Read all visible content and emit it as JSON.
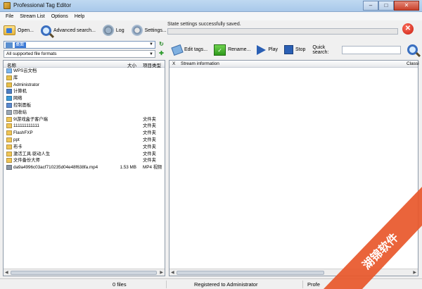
{
  "window": {
    "title": "Professional Tag Editor",
    "controls": {
      "minimize": "–",
      "maximize": "□",
      "close": "✕"
    }
  },
  "menu": [
    "File",
    "Stream List",
    "Options",
    "Help"
  ],
  "left_toolbar": {
    "open": "Open...",
    "advanced_search": "Advanced search...",
    "log": "Log",
    "settings": "Settings..."
  },
  "status": {
    "message": "State settings successfully saved.",
    "progress": 0
  },
  "path": {
    "selected": "桌面"
  },
  "format_filter": "All supported file formats",
  "file_list": {
    "columns": {
      "name": "名称",
      "size": "大小",
      "type": "项目类型"
    },
    "rows": [
      {
        "name": "WPS云文档",
        "size": "",
        "type": "",
        "icon": "cloud-icon"
      },
      {
        "name": "库",
        "size": "",
        "type": "",
        "icon": "library-icon"
      },
      {
        "name": "Administrator",
        "size": "",
        "type": "",
        "icon": "user-folder-icon"
      },
      {
        "name": "计算机",
        "size": "",
        "type": "",
        "icon": "computer-icon"
      },
      {
        "name": "网络",
        "size": "",
        "type": "",
        "icon": "network-icon"
      },
      {
        "name": "控制面板",
        "size": "",
        "type": "",
        "icon": "control-panel-icon"
      },
      {
        "name": "回收站",
        "size": "",
        "type": "",
        "icon": "recycle-bin-icon"
      },
      {
        "name": "9l游戏盒子客户端",
        "size": "",
        "type": "文件夹",
        "icon": "folder-icon"
      },
      {
        "name": "111111111111",
        "size": "",
        "type": "文件夹",
        "icon": "folder-icon"
      },
      {
        "name": "FlashFXP",
        "size": "",
        "type": "文件夹",
        "icon": "folder-icon"
      },
      {
        "name": "ppt",
        "size": "",
        "type": "文件夹",
        "icon": "folder-icon"
      },
      {
        "name": "布卡",
        "size": "",
        "type": "文件夹",
        "icon": "folder-icon"
      },
      {
        "name": "激活工具.驱动人生",
        "size": "",
        "type": "文件夹",
        "icon": "folder-icon"
      },
      {
        "name": "文件备份大师",
        "size": "",
        "type": "文件夹",
        "icon": "folder-icon"
      },
      {
        "name": "da9a4996c03acf710235d04e48f638fa.mp4",
        "size": "1.53 MB",
        "type": "MP4 视频",
        "icon": "video-file-icon"
      }
    ]
  },
  "right_toolbar": {
    "edit_tags": "Edit tags...",
    "rename": "Rename...",
    "play": "Play",
    "stop": "Stop",
    "quick_search_label": "Quick search:",
    "quick_search_value": ""
  },
  "stream_list": {
    "columns": {
      "x": "X",
      "info": "Stream information",
      "class": "Classi"
    }
  },
  "statusbar": {
    "files": "0 files",
    "registered": "Registered to Administrator",
    "right": "Profe"
  },
  "watermark": {
    "text": "湖锦软件"
  }
}
